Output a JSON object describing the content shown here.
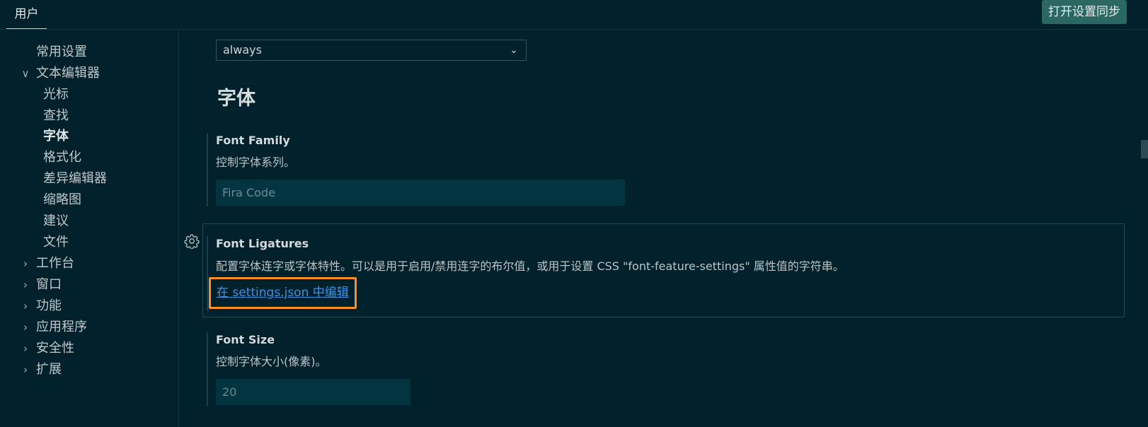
{
  "header": {
    "tab_user": "用户",
    "sync_button": "打开设置同步"
  },
  "sidebar": {
    "items": [
      {
        "label": "常用设置"
      },
      {
        "label": "文本编辑器",
        "chevron": "∨"
      },
      {
        "label": "光标"
      },
      {
        "label": "查找"
      },
      {
        "label": "字体"
      },
      {
        "label": "格式化"
      },
      {
        "label": "差异编辑器"
      },
      {
        "label": "缩略图"
      },
      {
        "label": "建议"
      },
      {
        "label": "文件"
      },
      {
        "label": "工作台",
        "chevron": "›"
      },
      {
        "label": "窗口",
        "chevron": "›"
      },
      {
        "label": "功能",
        "chevron": "›"
      },
      {
        "label": "应用程序",
        "chevron": "›"
      },
      {
        "label": "安全性",
        "chevron": "›"
      },
      {
        "label": "扩展",
        "chevron": "›"
      }
    ]
  },
  "main": {
    "top_select": {
      "value": "always"
    },
    "section_title": "字体",
    "font_family": {
      "title": "Font Family",
      "description": "控制字体系列。",
      "placeholder": "Fira Code"
    },
    "font_ligatures": {
      "title": "Font Ligatures",
      "description": "配置字体连字或字体特性。可以是用于启用/禁用连字的布尔值，或用于设置 CSS \"font-feature-settings\" 属性值的字符串。",
      "edit_link": "在 settings.json 中编辑"
    },
    "font_size": {
      "title": "Font Size",
      "description": "控制字体大小(像素)。",
      "placeholder": "20"
    }
  },
  "colors": {
    "background": "#00212b",
    "accent_button": "#2b6763",
    "link": "#3d92e0",
    "highlight_border": "#ff8f1f"
  },
  "icons": {
    "select_chevron": "chevron-down-icon",
    "settings_gear": "gear-icon"
  }
}
